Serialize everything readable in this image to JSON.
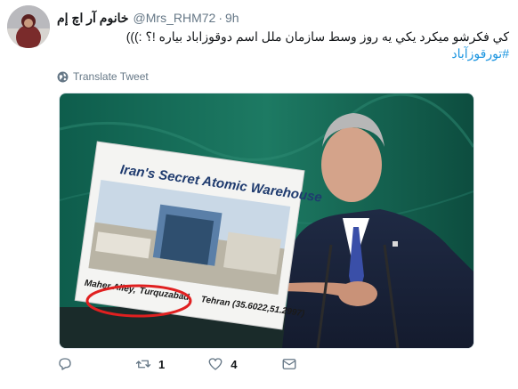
{
  "tweet": {
    "display_name": "خانوم آر اچ إم",
    "handle": "@Mrs_RHM72",
    "separator": "·",
    "time": "9h",
    "text": "كي فكرشو ميكرد يكي يه روز وسط سازمان ملل اسم دوقوزاباد بياره !؟ :)))",
    "hashtag": "#تورقوزآباد",
    "translate_label": "Translate Tweet"
  },
  "media": {
    "board_title": "Iran's Secret Atomic Warehouse",
    "board_caption_left": "Maher Alley,",
    "board_caption_mid": "Turquzabad,",
    "board_caption_right": "Tehran (35.6022,51.2997)",
    "highlight_color": "#e02020"
  },
  "actions": {
    "reply_count": "",
    "retweet_count": "1",
    "like_count": "4",
    "icons": [
      "reply-icon",
      "retweet-icon",
      "like-icon",
      "message-icon"
    ]
  },
  "colors": {
    "link": "#1b95e0",
    "secondary_text": "#657786",
    "primary_text": "#14171a"
  }
}
